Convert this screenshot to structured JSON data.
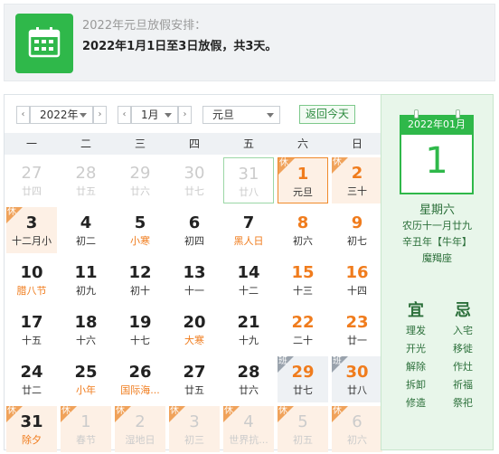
{
  "banner": {
    "line1": "2022年元旦放假安排：",
    "line2": "2022年1月1日至3日放假，共3天。",
    "icon": "calendar-icon"
  },
  "toolbar": {
    "prev_year": "‹",
    "year": "2022年",
    "next_year": "›",
    "prev_month": "‹",
    "month": "1月",
    "next_month": "›",
    "holiday": "元旦",
    "today_button": "返回今天"
  },
  "weekdays": [
    "一",
    "二",
    "三",
    "四",
    "五",
    "六",
    "日"
  ],
  "badges": {
    "rest": "休",
    "work": "班"
  },
  "days": [
    {
      "d": "27",
      "l": "廿四",
      "dim": true
    },
    {
      "d": "28",
      "l": "廿五",
      "dim": true
    },
    {
      "d": "29",
      "l": "廿六",
      "dim": true
    },
    {
      "d": "30",
      "l": "廿七",
      "dim": true
    },
    {
      "d": "31",
      "l": "廿八",
      "dim": true,
      "hover": true
    },
    {
      "d": "1",
      "l": "元旦",
      "rest": true,
      "wknd": true,
      "selected": true
    },
    {
      "d": "2",
      "l": "三十",
      "rest": true,
      "wknd": true
    },
    {
      "d": "3",
      "l": "十二月小",
      "rest": true
    },
    {
      "d": "4",
      "l": "初二"
    },
    {
      "d": "5",
      "l": "小寒",
      "lred": true
    },
    {
      "d": "6",
      "l": "初四"
    },
    {
      "d": "7",
      "l": "黑人日",
      "lred": true
    },
    {
      "d": "8",
      "l": "初六",
      "wknd": true
    },
    {
      "d": "9",
      "l": "初七",
      "wknd": true
    },
    {
      "d": "10",
      "l": "腊八节",
      "lred": true
    },
    {
      "d": "11",
      "l": "初九"
    },
    {
      "d": "12",
      "l": "初十"
    },
    {
      "d": "13",
      "l": "十一"
    },
    {
      "d": "14",
      "l": "十二"
    },
    {
      "d": "15",
      "l": "十三",
      "wknd": true
    },
    {
      "d": "16",
      "l": "十四",
      "wknd": true
    },
    {
      "d": "17",
      "l": "十五"
    },
    {
      "d": "18",
      "l": "十六"
    },
    {
      "d": "19",
      "l": "十七"
    },
    {
      "d": "20",
      "l": "大寒",
      "lred": true
    },
    {
      "d": "21",
      "l": "十九"
    },
    {
      "d": "22",
      "l": "二十",
      "wknd": true
    },
    {
      "d": "23",
      "l": "廿一",
      "wknd": true
    },
    {
      "d": "24",
      "l": "廿二"
    },
    {
      "d": "25",
      "l": "小年",
      "lred": true
    },
    {
      "d": "26",
      "l": "国际海...",
      "lred": true
    },
    {
      "d": "27",
      "l": "廿五"
    },
    {
      "d": "28",
      "l": "廿六"
    },
    {
      "d": "29",
      "l": "廿七",
      "work": true,
      "wknd": true
    },
    {
      "d": "30",
      "l": "廿八",
      "work": true,
      "wknd": true
    },
    {
      "d": "31",
      "l": "除夕",
      "rest": true,
      "lred": true
    },
    {
      "d": "1",
      "l": "春节",
      "rest": true,
      "dim": true
    },
    {
      "d": "2",
      "l": "湿地日",
      "rest": true,
      "dim": true
    },
    {
      "d": "3",
      "l": "初三",
      "rest": true,
      "dim": true
    },
    {
      "d": "4",
      "l": "世界抗...",
      "rest": true,
      "dim": true
    },
    {
      "d": "5",
      "l": "初五",
      "rest": true,
      "dim": true
    },
    {
      "d": "6",
      "l": "初六",
      "rest": true,
      "dim": true
    }
  ],
  "side": {
    "header": "2022年01月",
    "day": "1",
    "weekday": "星期六",
    "lunar": "农历十一月廿九",
    "ganzhi": "辛丑年【牛年】",
    "constellation": "魔羯座",
    "yi_title": "宜",
    "ji_title": "忌",
    "yi": [
      "理发",
      "开光",
      "解除",
      "拆卸",
      "修造"
    ],
    "ji": [
      "入宅",
      "移徙",
      "作灶",
      "祈福",
      "祭祀"
    ]
  }
}
